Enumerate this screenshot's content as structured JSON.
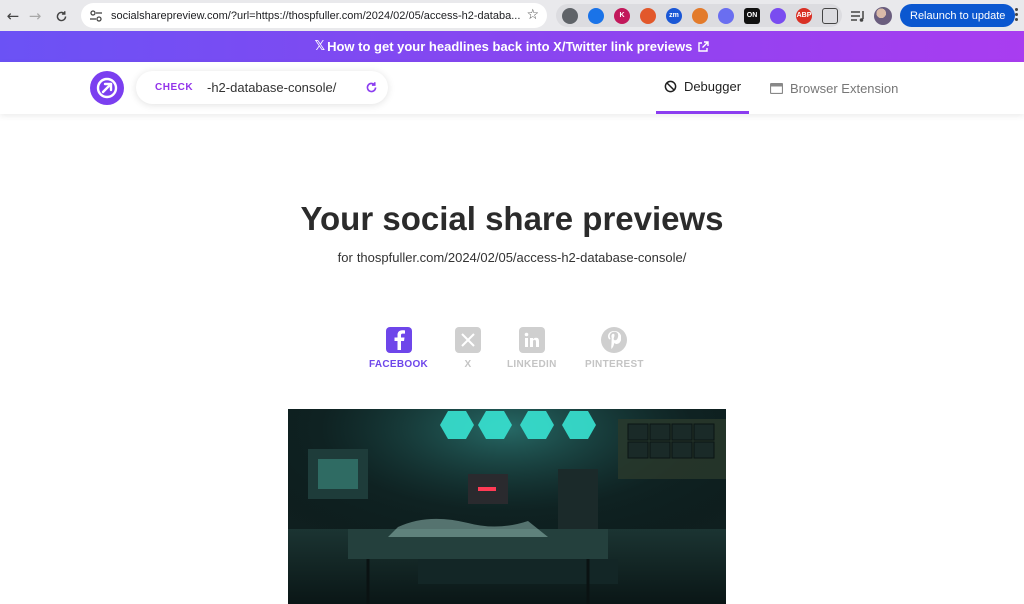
{
  "browser": {
    "url": "socialsharepreview.com/?url=https://thospfuller.com/2024/02/05/access-h2-databa...",
    "relaunch_label": "Relaunch to update",
    "extensions": [
      {
        "name": "ext-icon-1",
        "color": "#5f6368",
        "text": ""
      },
      {
        "name": "ext-icon-2",
        "color": "#1a73e8",
        "text": ""
      },
      {
        "name": "ext-icon-k",
        "color": "#c2185b",
        "text": "K"
      },
      {
        "name": "ext-icon-wp",
        "color": "#e2582b",
        "text": ""
      },
      {
        "name": "ext-icon-zm",
        "color": "#1a57d6",
        "text": "zm"
      },
      {
        "name": "ext-icon-fox",
        "color": "#e37b2b",
        "text": ""
      },
      {
        "name": "ext-icon-cloud",
        "color": "#6a6ef0",
        "text": ""
      },
      {
        "name": "ext-icon-on",
        "color": "#111111",
        "text": "ON"
      },
      {
        "name": "ext-icon-circle",
        "color": "#7a4cf0",
        "text": ""
      },
      {
        "name": "ext-icon-abp",
        "color": "#d93025",
        "text": "ABP"
      }
    ]
  },
  "banner": {
    "x_glyph": "𝕏",
    "text": "How to get your headlines back into X/Twitter link previews"
  },
  "header": {
    "check_label": "CHECK",
    "url_value": "-h2-database-console/",
    "tabs": [
      {
        "label": "Debugger"
      },
      {
        "label": "Browser Extension"
      }
    ]
  },
  "main": {
    "title": "Your social share previews",
    "subtitle_prefix": "for",
    "subtitle_url": "thospfuller.com/2024/02/05/access-h2-database-console/",
    "platforms": [
      {
        "label": "FACEBOOK"
      },
      {
        "label": "X"
      },
      {
        "label": "LINKEDIN"
      },
      {
        "label": "PINTEREST"
      }
    ]
  },
  "colors": {
    "accent": "#8b3df0",
    "facebook_active": "#6e46ea",
    "inactive": "#c4c4c4",
    "relaunch": "#0b57d0"
  }
}
